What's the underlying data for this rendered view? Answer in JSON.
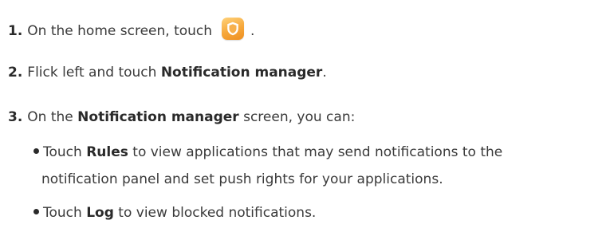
{
  "steps": [
    {
      "number": "1.",
      "text_before": "On the home screen, touch",
      "icon": "phone-manager-shield-icon",
      "text_after": "."
    },
    {
      "number": "2.",
      "text_before": "Flick left and touch ",
      "bold": "Notification manager",
      "text_after": "."
    },
    {
      "number": "3.",
      "text_before": "On the ",
      "bold": "Notification manager",
      "text_after": " screen, you can:"
    }
  ],
  "bullets": [
    {
      "text_before": "Touch ",
      "bold": "Rules",
      "text_line1": " to view applications that may send notifications to the",
      "text_line2": "notification panel and set push rights for your applications."
    },
    {
      "text_before": "Touch ",
      "bold": "Log",
      "text_after": " to view blocked notifications."
    }
  ],
  "colors": {
    "text": "#3a3a3a",
    "icon_orange": "#f6a73b"
  }
}
